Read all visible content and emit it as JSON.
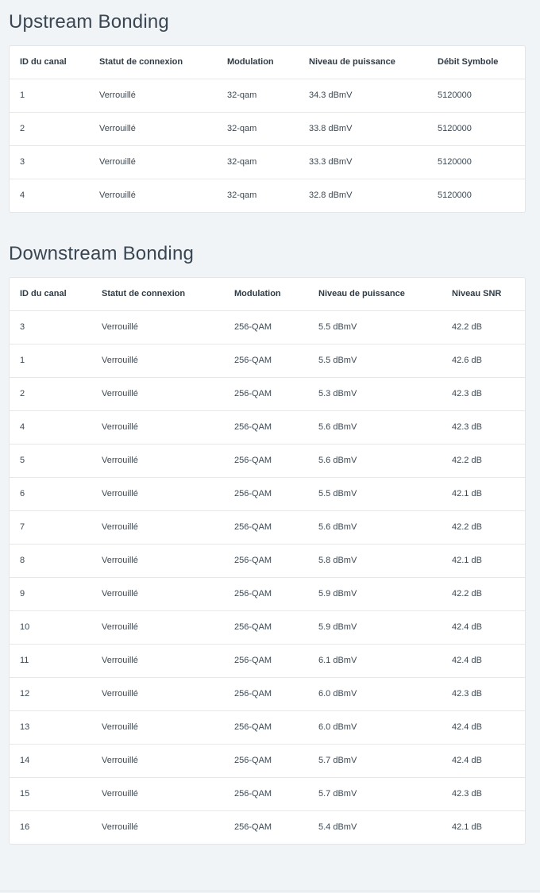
{
  "upstream": {
    "title": "Upstream Bonding",
    "headers": [
      "ID du canal",
      "Statut de connexion",
      "Modulation",
      "Niveau de puissance",
      "Débit Symbole"
    ],
    "rows": [
      [
        "1",
        "Verrouillé",
        "32-qam",
        "34.3 dBmV",
        "5120000"
      ],
      [
        "2",
        "Verrouillé",
        "32-qam",
        "33.8 dBmV",
        "5120000"
      ],
      [
        "3",
        "Verrouillé",
        "32-qam",
        "33.3 dBmV",
        "5120000"
      ],
      [
        "4",
        "Verrouillé",
        "32-qam",
        "32.8 dBmV",
        "5120000"
      ]
    ]
  },
  "downstream": {
    "title": "Downstream Bonding",
    "headers": [
      "ID du canal",
      "Statut de connexion",
      "Modulation",
      "Niveau de puissance",
      "Niveau SNR"
    ],
    "rows": [
      [
        "3",
        "Verrouillé",
        "256-QAM",
        "5.5 dBmV",
        "42.2 dB"
      ],
      [
        "1",
        "Verrouillé",
        "256-QAM",
        "5.5 dBmV",
        "42.6 dB"
      ],
      [
        "2",
        "Verrouillé",
        "256-QAM",
        "5.3 dBmV",
        "42.3 dB"
      ],
      [
        "4",
        "Verrouillé",
        "256-QAM",
        "5.6 dBmV",
        "42.3 dB"
      ],
      [
        "5",
        "Verrouillé",
        "256-QAM",
        "5.6 dBmV",
        "42.2 dB"
      ],
      [
        "6",
        "Verrouillé",
        "256-QAM",
        "5.5 dBmV",
        "42.1 dB"
      ],
      [
        "7",
        "Verrouillé",
        "256-QAM",
        "5.6 dBmV",
        "42.2 dB"
      ],
      [
        "8",
        "Verrouillé",
        "256-QAM",
        "5.8 dBmV",
        "42.1 dB"
      ],
      [
        "9",
        "Verrouillé",
        "256-QAM",
        "5.9 dBmV",
        "42.2 dB"
      ],
      [
        "10",
        "Verrouillé",
        "256-QAM",
        "5.9 dBmV",
        "42.4 dB"
      ],
      [
        "11",
        "Verrouillé",
        "256-QAM",
        "6.1 dBmV",
        "42.4 dB"
      ],
      [
        "12",
        "Verrouillé",
        "256-QAM",
        "6.0 dBmV",
        "42.3 dB"
      ],
      [
        "13",
        "Verrouillé",
        "256-QAM",
        "6.0 dBmV",
        "42.4 dB"
      ],
      [
        "14",
        "Verrouillé",
        "256-QAM",
        "5.7 dBmV",
        "42.4 dB"
      ],
      [
        "15",
        "Verrouillé",
        "256-QAM",
        "5.7 dBmV",
        "42.3 dB"
      ],
      [
        "16",
        "Verrouillé",
        "256-QAM",
        "5.4 dBmV",
        "42.1 dB"
      ]
    ]
  }
}
